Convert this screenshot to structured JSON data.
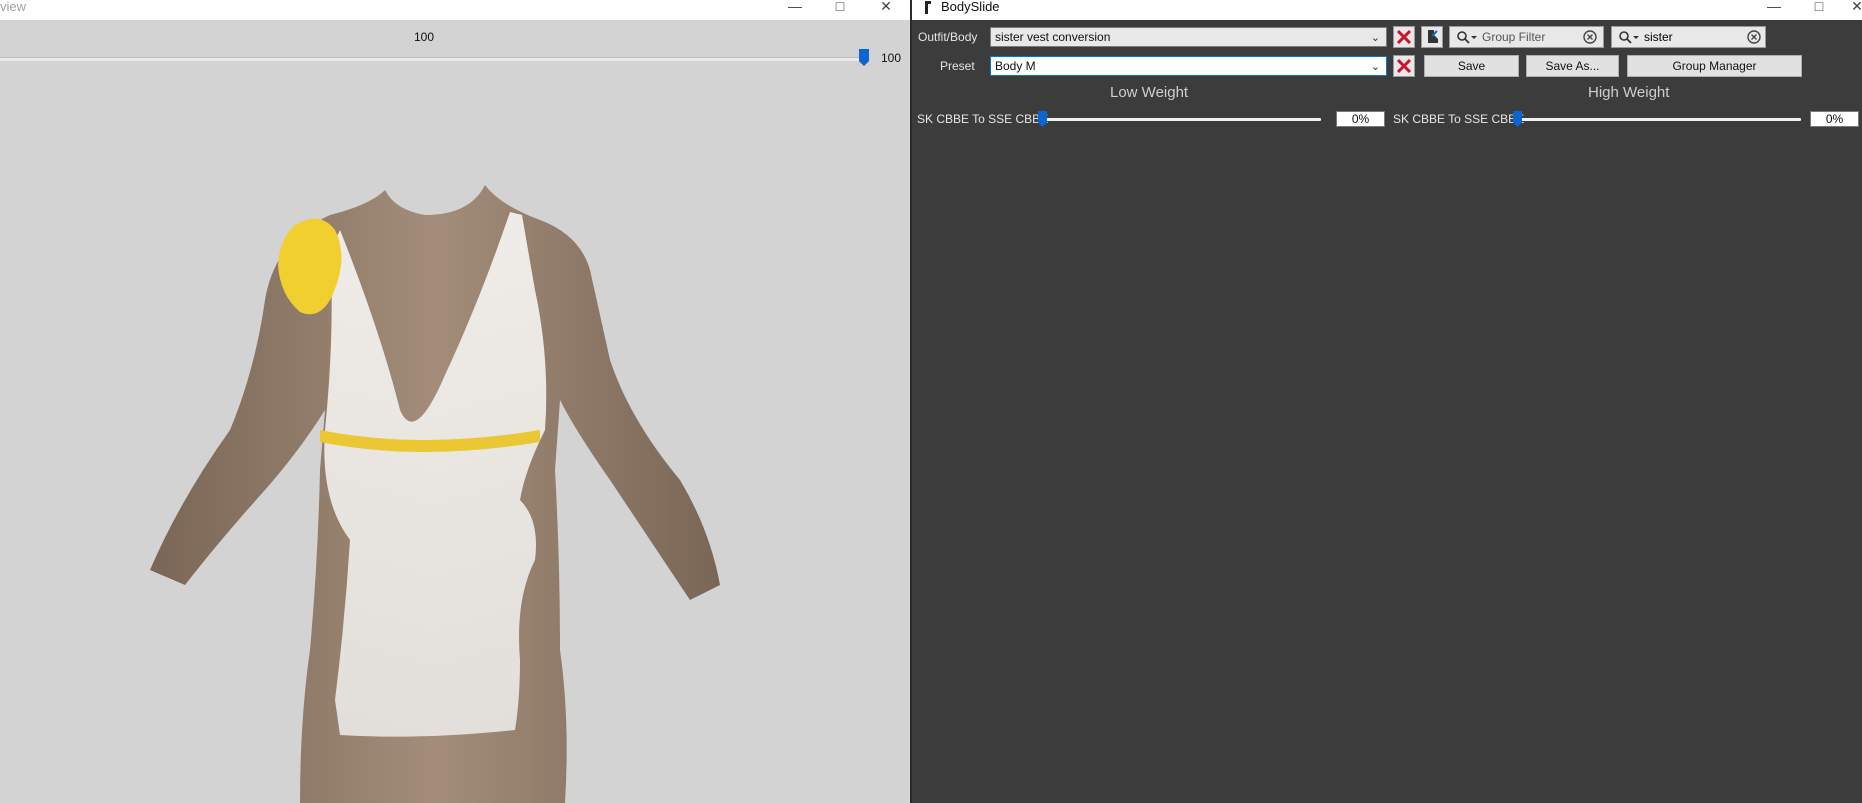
{
  "preview": {
    "title": "view",
    "slider_value_top": "100",
    "slider_value_right": "100",
    "slider_level_percent": 100
  },
  "bodyslide": {
    "title": "BodySlide",
    "outfit_label": "Outfit/Body",
    "outfit_value": "sister vest conversion",
    "preset_label": "Preset",
    "preset_value": "Body M",
    "group_filter_placeholder": "Group Filter",
    "outfit_filter_value": "sister",
    "save_label": "Save",
    "save_as_label": "Save As...",
    "group_manager_label": "Group Manager",
    "low_weight_label": "Low Weight",
    "high_weight_label": "High Weight",
    "sliders": [
      {
        "name": "SK CBBE To SSE CBBE",
        "low_value": "0%",
        "high_value": "0%"
      }
    ]
  },
  "colors": {
    "accent": "#0a66d0",
    "panel_bg": "#3c3c3c",
    "preview_bg": "#d3d3d3",
    "close_x": "#d0102a"
  },
  "icons": {
    "minimize": "minimize-icon",
    "maximize": "maximize-icon",
    "close": "close-icon",
    "clear": "clear-red-x-icon",
    "search": "search-dropdown-icon"
  }
}
